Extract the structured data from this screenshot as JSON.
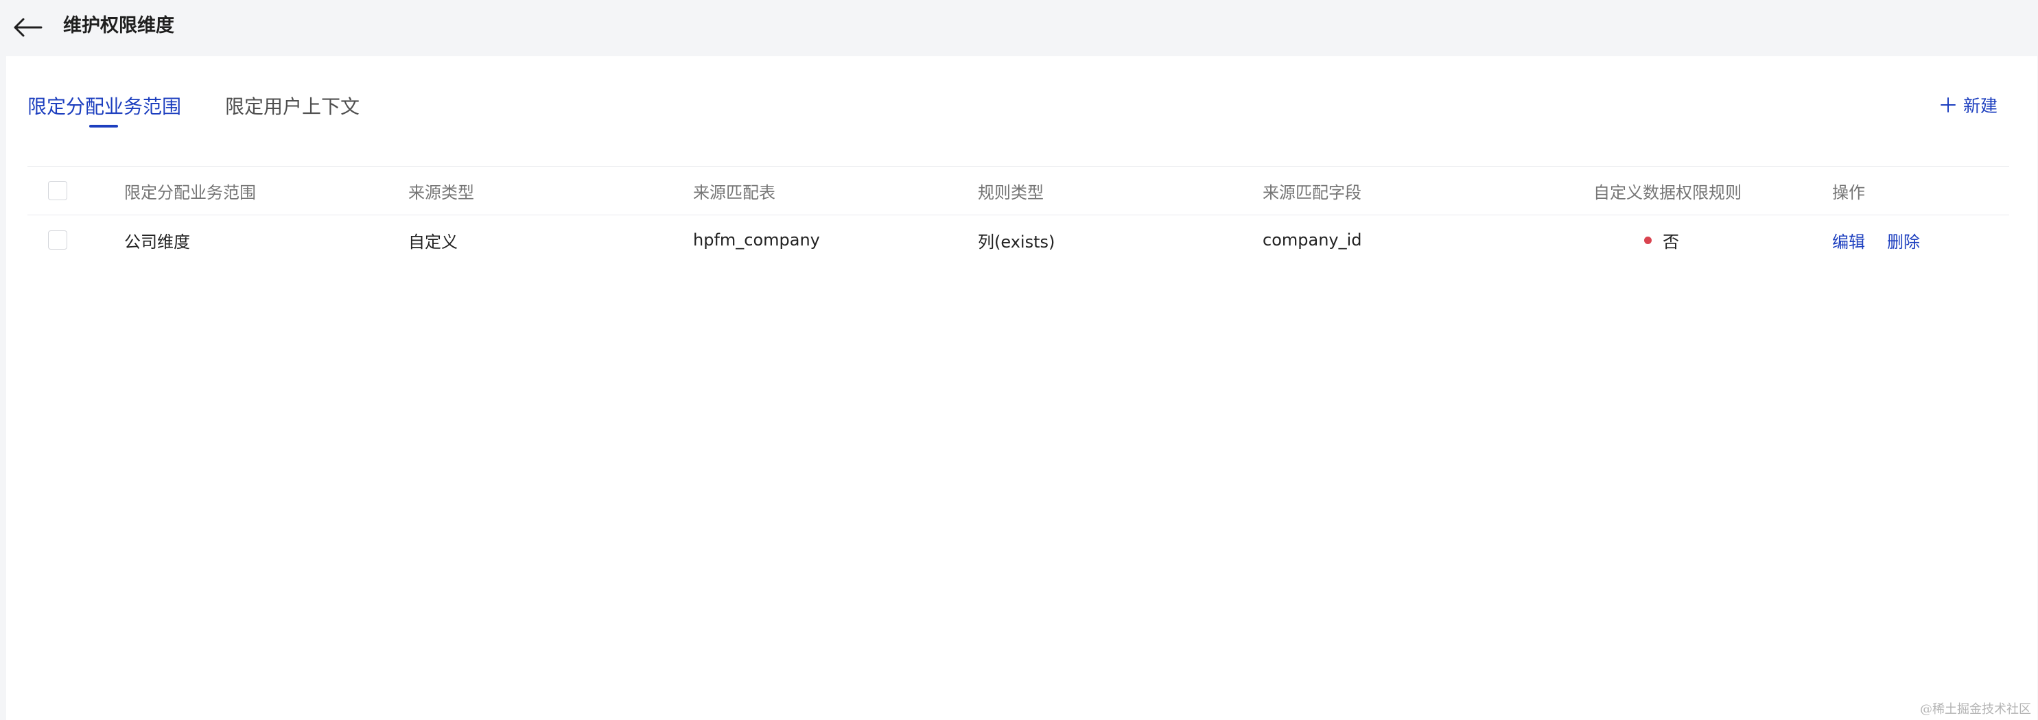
{
  "header": {
    "title": "维护权限维度",
    "back_icon": "arrow-left-icon"
  },
  "tabs": [
    {
      "label": "限定分配业务范围",
      "active": true
    },
    {
      "label": "限定用户上下文",
      "active": false
    }
  ],
  "toolbar": {
    "new_label": "新建",
    "new_icon": "plus-icon"
  },
  "table": {
    "columns": [
      "限定分配业务范围",
      "来源类型",
      "来源匹配表",
      "规则类型",
      "来源匹配字段",
      "自定义数据权限规则",
      "操作"
    ],
    "rows": [
      {
        "name": "公司维度",
        "source_type": "自定义",
        "source_table": "hpfm_company",
        "rule_type": "列(exists)",
        "source_field": "company_id",
        "custom_rule": "否",
        "actions": {
          "edit": "编辑",
          "delete": "删除"
        }
      }
    ]
  },
  "watermark": "@稀土掘金技术社区",
  "colors": {
    "accent": "#1d3fbf",
    "status_no": "#d9434f",
    "background": "#f4f5f7",
    "panel": "#ffffff"
  }
}
